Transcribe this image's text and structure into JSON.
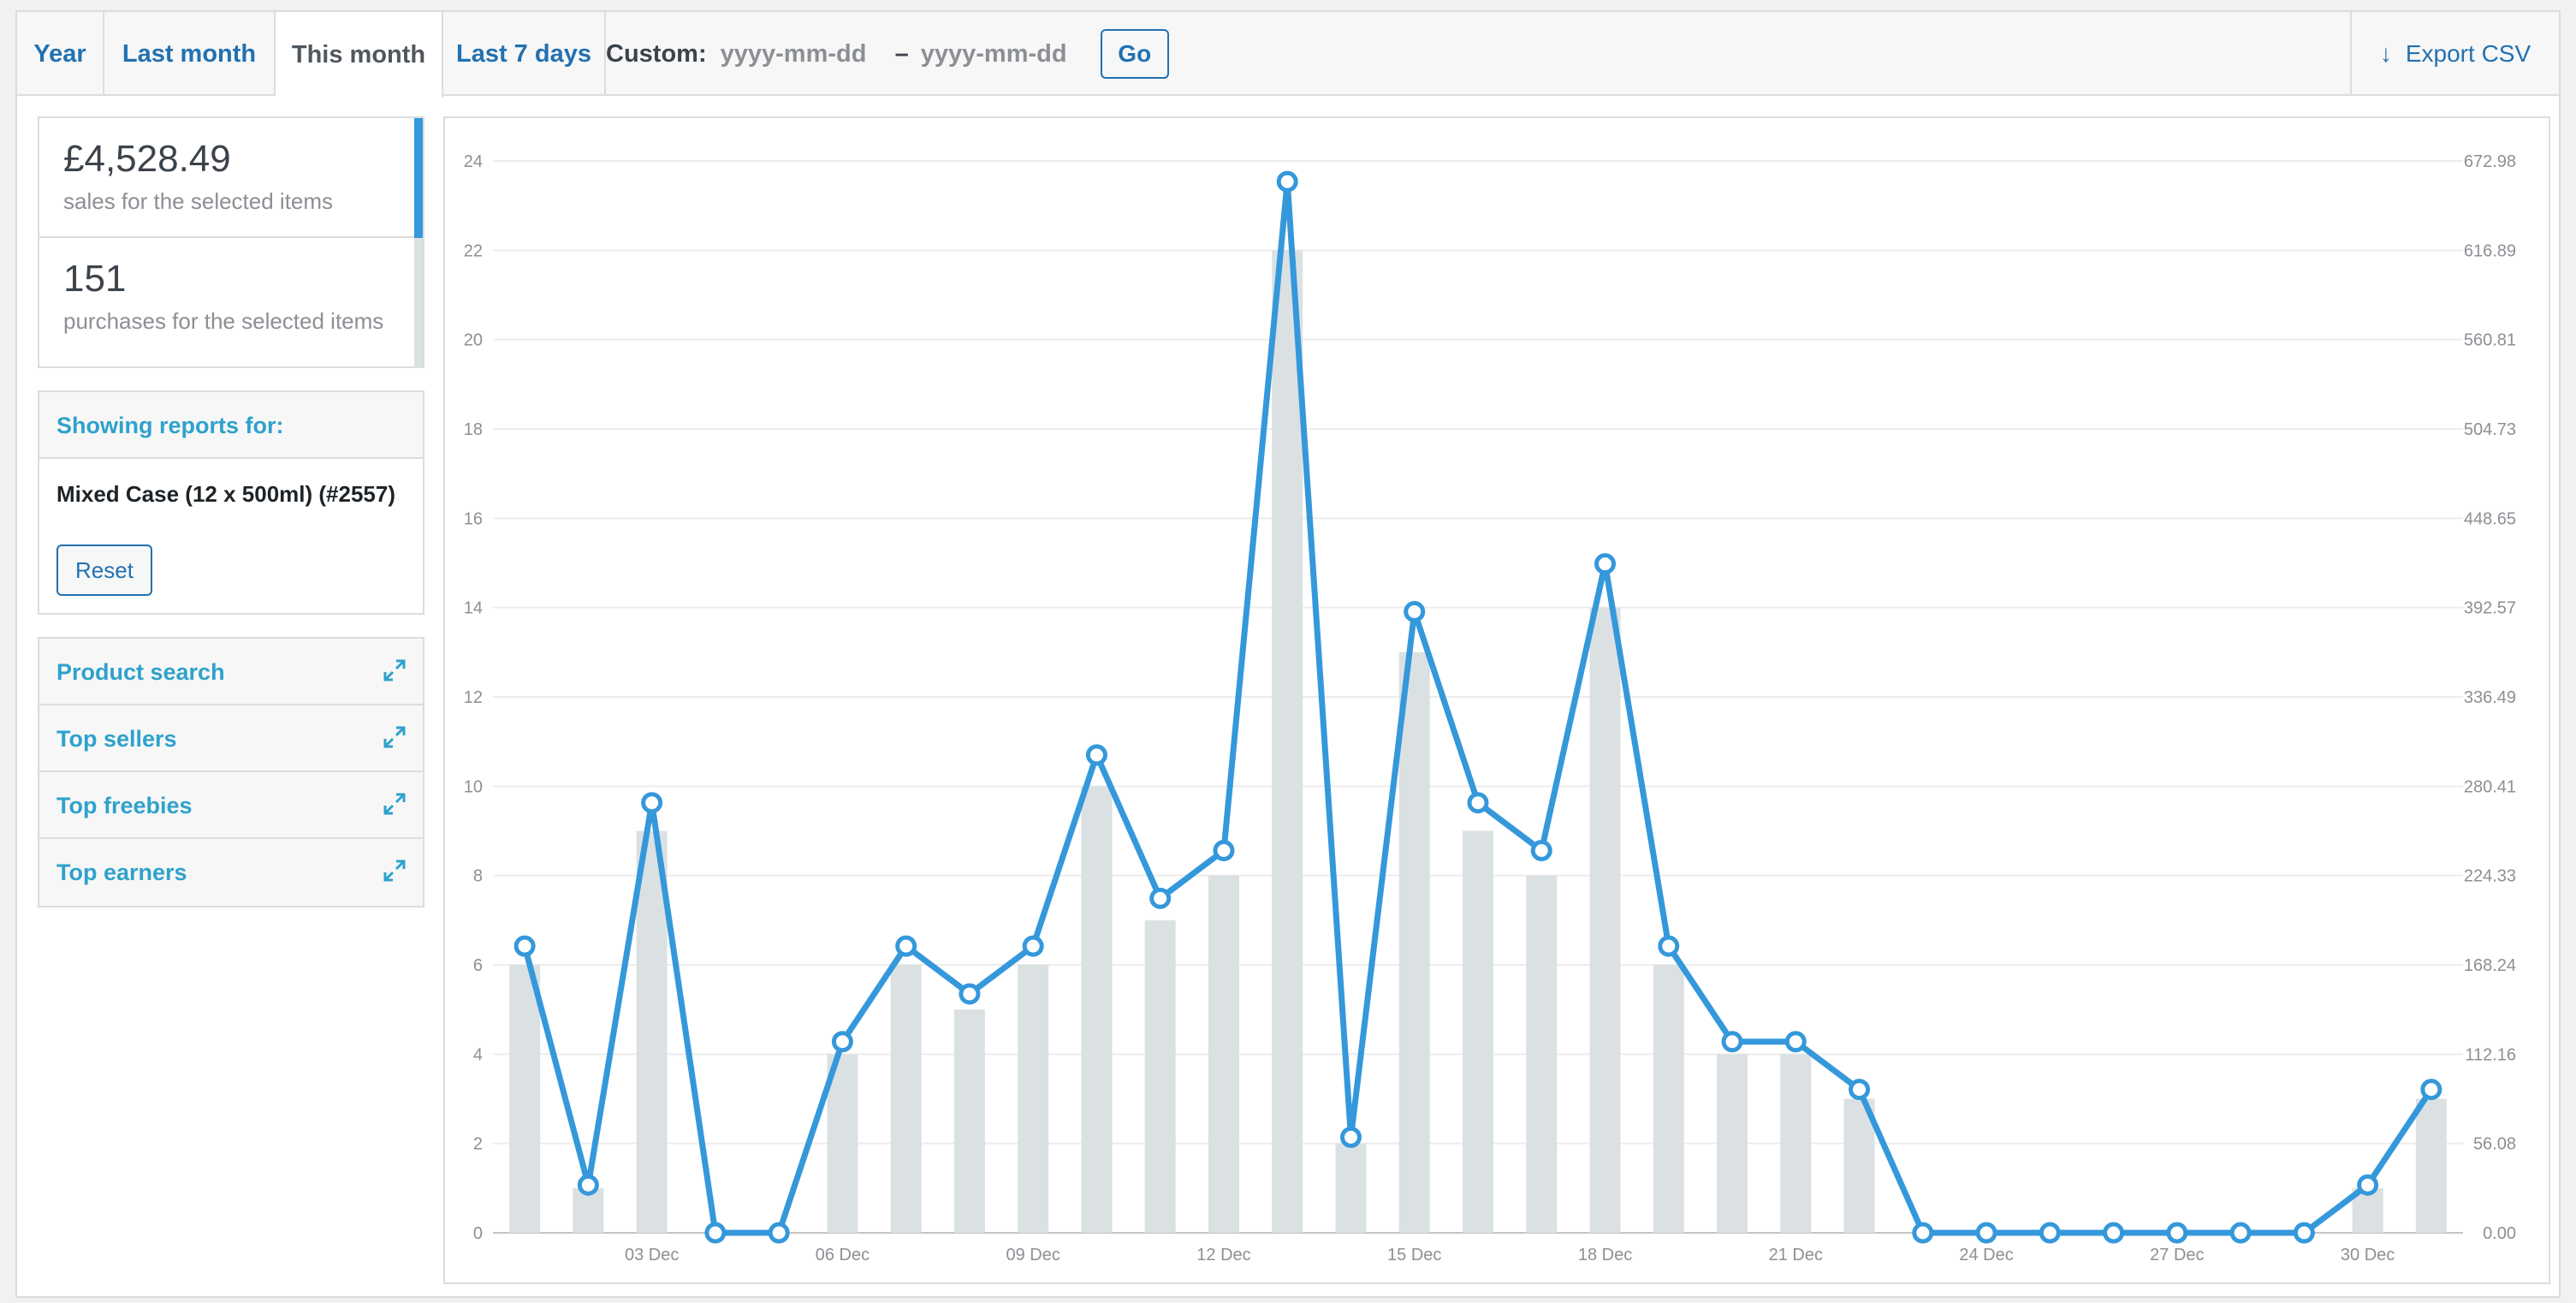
{
  "tabs": [
    {
      "label": "Year"
    },
    {
      "label": "Last month"
    },
    {
      "label": "This month"
    },
    {
      "label": "Last 7 days"
    }
  ],
  "custom": {
    "label": "Custom:",
    "from_placeholder": "yyyy-mm-dd",
    "separator": "–",
    "to_placeholder": "yyyy-mm-dd",
    "go_label": "Go"
  },
  "export": {
    "label": "Export CSV",
    "icon": "download-arrow-icon"
  },
  "stats": {
    "sales_value": "£4,528.49",
    "sales_label": "sales for the selected items",
    "purchases_value": "151",
    "purchases_label": "purchases for the selected items"
  },
  "showing": {
    "title": "Showing reports for:",
    "product": "Mixed Case (12 x 500ml) (#2557)",
    "reset_label": "Reset"
  },
  "widgets": [
    {
      "label": "Product search",
      "icon": "expand-icon"
    },
    {
      "label": "Top sellers",
      "icon": "expand-icon"
    },
    {
      "label": "Top freebies",
      "icon": "expand-icon"
    },
    {
      "label": "Top earners",
      "icon": "expand-icon"
    }
  ],
  "colors": {
    "accent": "#2271b1",
    "series_line": "#3498db",
    "series_bar": "#dbe1e3"
  },
  "chart_data": {
    "type": "bar",
    "x_tick_labels": [
      "03 Dec",
      "06 Dec",
      "09 Dec",
      "12 Dec",
      "15 Dec",
      "18 Dec",
      "21 Dec",
      "24 Dec",
      "27 Dec",
      "30 Dec"
    ],
    "x": [
      "01 Dec",
      "02 Dec",
      "03 Dec",
      "04 Dec",
      "05 Dec",
      "06 Dec",
      "07 Dec",
      "08 Dec",
      "09 Dec",
      "10 Dec",
      "11 Dec",
      "12 Dec",
      "13 Dec",
      "14 Dec",
      "15 Dec",
      "16 Dec",
      "17 Dec",
      "18 Dec",
      "19 Dec",
      "20 Dec",
      "21 Dec",
      "22 Dec",
      "23 Dec",
      "24 Dec",
      "25 Dec",
      "26 Dec",
      "27 Dec",
      "28 Dec",
      "29 Dec",
      "30 Dec",
      "31 Dec"
    ],
    "series": [
      {
        "values": [
          6,
          1,
          9,
          0,
          0,
          4,
          6,
          5,
          6,
          10,
          7,
          8,
          22,
          2,
          13,
          9,
          8,
          14,
          6,
          4,
          4,
          3,
          0,
          0,
          0,
          0,
          0,
          0,
          0,
          1,
          3
        ],
        "axis": "left",
        "type": "bar"
      },
      {
        "values": [
          180,
          30,
          270,
          0,
          0,
          120,
          180,
          150,
          180,
          300,
          210,
          240,
          660,
          60,
          390,
          270,
          240,
          420,
          180,
          120,
          120,
          90,
          0,
          0,
          0,
          0,
          0,
          0,
          0,
          30,
          90
        ],
        "axis": "right",
        "type": "line"
      }
    ],
    "y_left_ticks": [
      "0",
      "2",
      "4",
      "6",
      "8",
      "10",
      "12",
      "14",
      "16",
      "18",
      "20",
      "22",
      "24"
    ],
    "y_right_ticks": [
      "0.00",
      "56.08",
      "112.16",
      "168.24",
      "224.33",
      "280.41",
      "336.49",
      "392.57",
      "448.65",
      "504.73",
      "560.81",
      "616.89",
      "672.98"
    ],
    "ylim_left": [
      0,
      24
    ],
    "ylim_right": [
      0,
      672.98
    ],
    "grid": true
  }
}
